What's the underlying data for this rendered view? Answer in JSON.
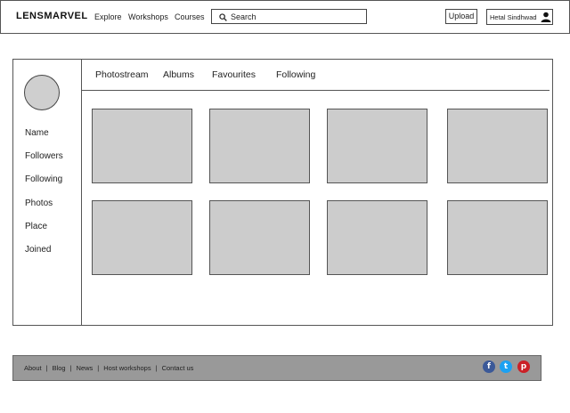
{
  "header": {
    "brand": "LENSMARVEL",
    "nav": [
      "Explore",
      "Workshops",
      "Courses"
    ],
    "search_placeholder": "Search",
    "upload_label": "Upload",
    "user_name": "Hetal Sindhwad"
  },
  "profile": {
    "fields": [
      "Name",
      "Followers",
      "Following",
      "Photos",
      "Place",
      "Joined"
    ]
  },
  "tabs": [
    "Photostream",
    "Albums",
    "Favourites",
    "Following"
  ],
  "photos_count": 8,
  "footer": {
    "links": [
      "About",
      "Blog",
      "News",
      "Host workshops",
      "Contact us"
    ],
    "social": [
      {
        "name": "facebook-icon",
        "glyph": "f",
        "color": "#3b5998"
      },
      {
        "name": "twitter-icon",
        "glyph": "t",
        "color": "#1da1f2"
      },
      {
        "name": "pinterest-icon",
        "glyph": "p",
        "color": "#cb2027"
      }
    ]
  },
  "colors": {
    "placeholder_fill": "#cccccc",
    "footer_bg": "#999999",
    "border": "#555555"
  }
}
